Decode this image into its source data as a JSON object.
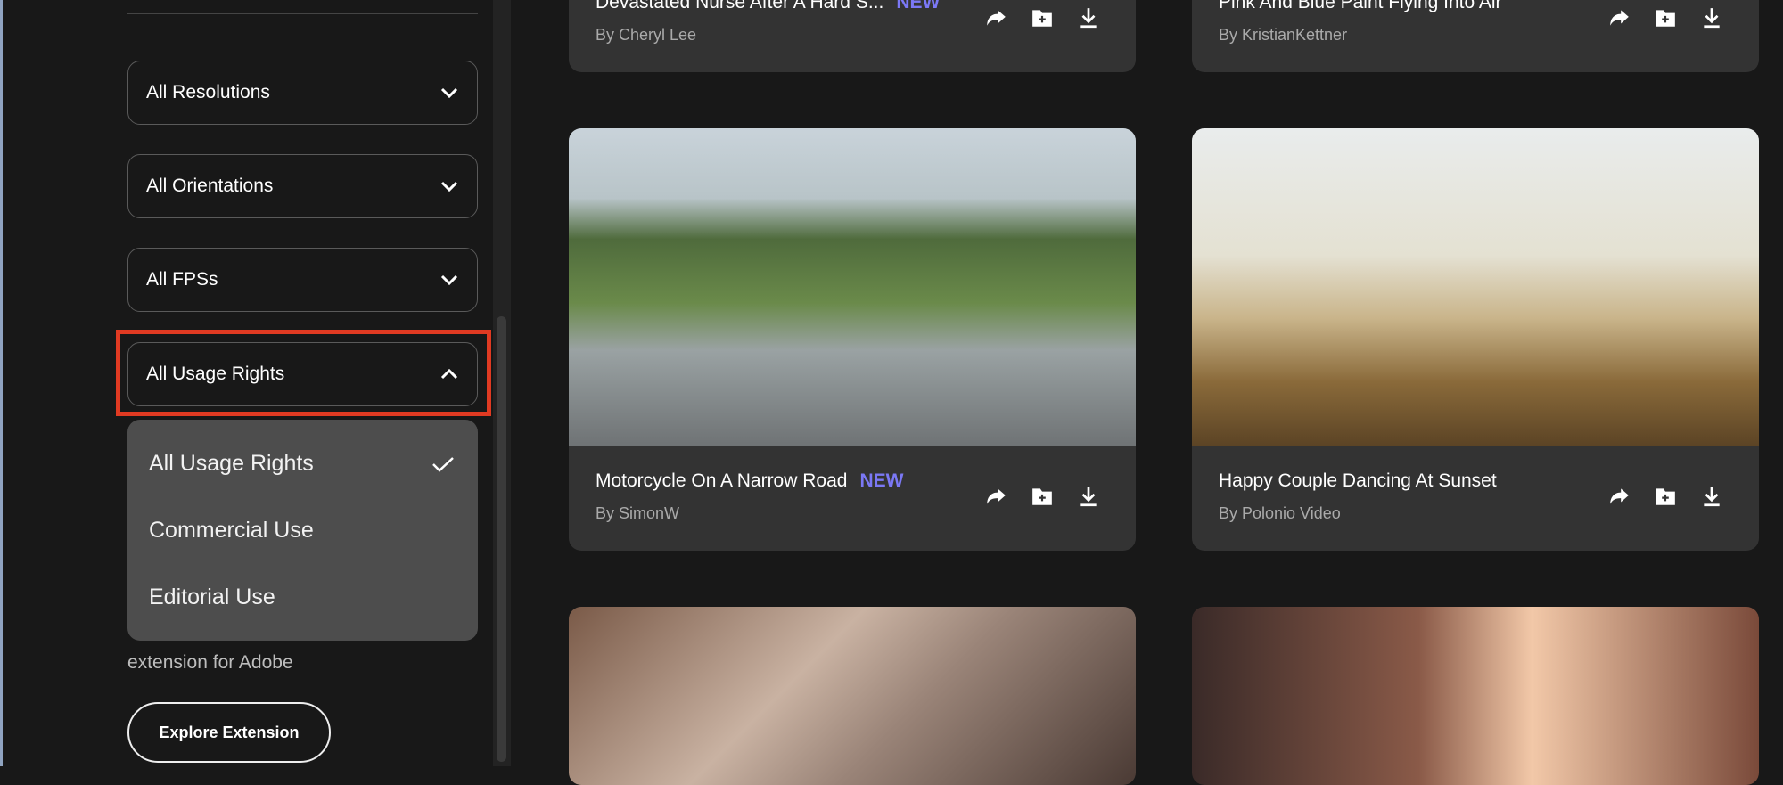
{
  "filters": {
    "resolutions": "All Resolutions",
    "orientations": "All Orientations",
    "fps": "All FPSs",
    "usage_rights": "All Usage Rights"
  },
  "usage_menu": {
    "options": [
      "All Usage Rights",
      "Commercial Use",
      "Editorial Use"
    ],
    "selected": "All Usage Rights"
  },
  "promo": {
    "text": "extension for Adobe",
    "button": "Explore Extension"
  },
  "cards": [
    {
      "title": "Devastated Nurse After A Hard S...",
      "badge": "NEW",
      "author": "By Cheryl Lee"
    },
    {
      "title": "Pink And Blue Paint Flying Into Air",
      "badge": "",
      "author": "By KristianKettner"
    },
    {
      "title": "Motorcycle On A Narrow Road",
      "badge": "NEW",
      "author": "By SimonW"
    },
    {
      "title": "Happy Couple Dancing At Sunset",
      "badge": "",
      "author": "By Polonio Video"
    }
  ],
  "colors": {
    "accent": "#7b78f5",
    "highlight": "#e03a22"
  }
}
